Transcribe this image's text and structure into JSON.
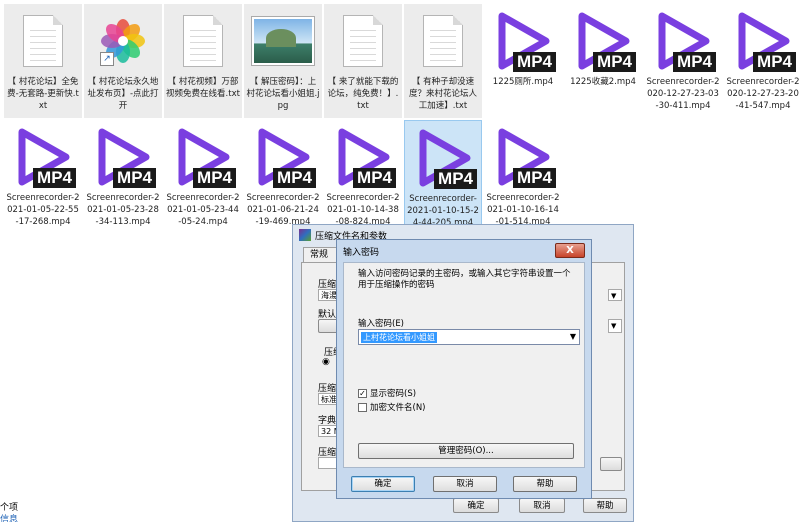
{
  "files_row1": [
    {
      "icon": "text-file-icon",
      "label": "【 村花论坛】全免费-无套路-更新快.txt"
    },
    {
      "icon": "photos-shortcut-icon",
      "label": "【 村花论坛永久地址发布页】-点此打开"
    },
    {
      "icon": "text-file-icon",
      "label": "【 村花视频】万部视频免费在线看.txt"
    },
    {
      "icon": "image-file-icon",
      "label": "【 解压密码】：上村花论坛看小姐姐.jpg"
    },
    {
      "icon": "text-file-icon",
      "label": "【 来了就能下载的论坛，纯免费！】.txt"
    },
    {
      "icon": "text-file-icon",
      "label": "【 有种子却没速度？来村花论坛人工加速】.txt"
    },
    {
      "icon": "mp4-file-icon",
      "label": "1225厕所.mp4"
    },
    {
      "icon": "mp4-file-icon",
      "label": "1225收藏2.mp4"
    },
    {
      "icon": "mp4-file-icon",
      "label": "Screenrecorder-2020-12-27-23-03-30-411.mp4"
    },
    {
      "icon": "mp4-file-icon",
      "label": "Screenrecorder-2020-12-27-23-20-41-547.mp4"
    }
  ],
  "files_row2": [
    {
      "icon": "mp4-file-icon",
      "label": "Screenrecorder-2021-01-05-22-55-17-268.mp4"
    },
    {
      "icon": "mp4-file-icon",
      "label": "Screenrecorder-2021-01-05-23-28-34-113.mp4"
    },
    {
      "icon": "mp4-file-icon",
      "label": "Screenrecorder-2021-01-05-23-44-05-24.mp4"
    },
    {
      "icon": "mp4-file-icon",
      "label": "Screenrecorder-2021-01-06-21-24-19-469.mp4"
    },
    {
      "icon": "mp4-file-icon",
      "label": "Screenrecorder-2021-01-10-14-38-08-824.mp4"
    },
    {
      "icon": "mp4-file-icon",
      "label": "Screenrecorder-2021-01-10-15-24-44-205.mp4"
    },
    {
      "icon": "mp4-file-icon",
      "label": "Screenrecorder-2021-01-10-16-14-01-514.mp4"
    }
  ],
  "mp4_badge": "MP4",
  "colors": {
    "mp4_triangle": "#7a3fe0",
    "selection": "#cce4f7"
  },
  "archive_dialog": {
    "title": "压缩文件名和参数",
    "tab_general": "常规",
    "label_name": "压缩文",
    "name_value": "海湯",
    "label_default": "默认配",
    "label_format": "压缩",
    "label_method": "压缩方",
    "method_value": "标准",
    "label_dict": "字典大",
    "dict_value": "32 M",
    "label_split": "压缩为",
    "ok": "确定",
    "cancel": "取消",
    "help": "帮助"
  },
  "password_dialog": {
    "title": "输入密码",
    "close": "X",
    "message": "输入访问密码记录的主密码，或输入其它字符串设置一个用于压缩操作的密码",
    "label_password": "输入密码(E)",
    "password_value": "上村花论坛看小姐姐",
    "show_password": "显示密码(S)",
    "show_password_checked": true,
    "encrypt_names": "加密文件名(N)",
    "encrypt_names_checked": false,
    "manage_button": "管理密码(O)...",
    "ok": "确定",
    "cancel": "取消",
    "help": "帮助"
  },
  "bottom_left": [
    "个项",
    "信息"
  ]
}
